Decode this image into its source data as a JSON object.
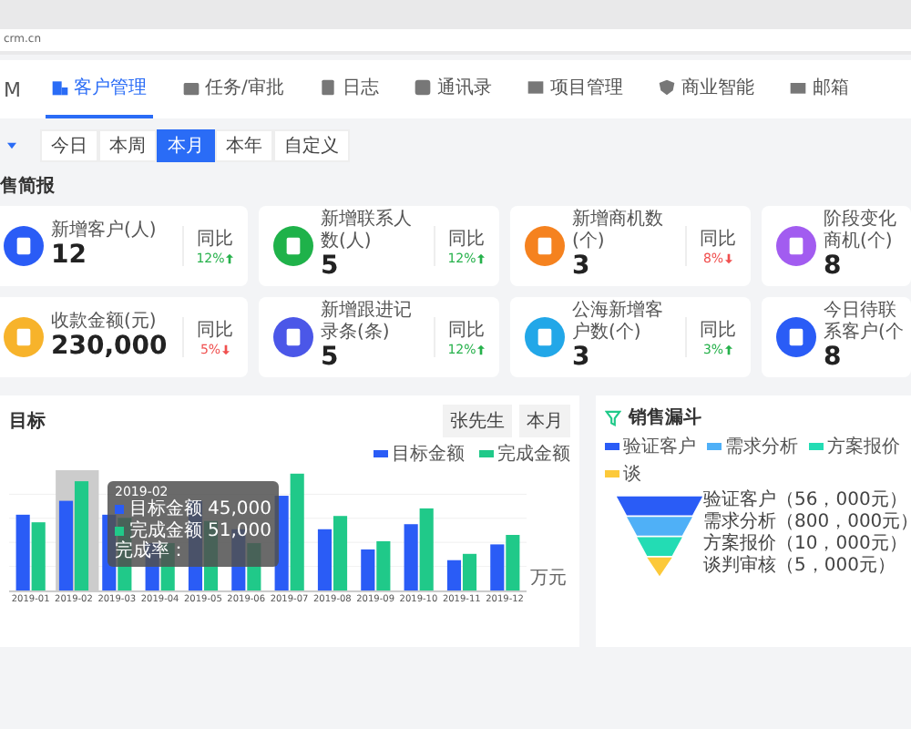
{
  "browser": {
    "address": "crm.cn"
  },
  "logo_fragment": "M",
  "nav": [
    {
      "label": "客户管理",
      "selected": true
    },
    {
      "label": "任务/审批",
      "selected": false
    },
    {
      "label": "日志",
      "selected": false
    },
    {
      "label": "通讯录",
      "selected": false
    },
    {
      "label": "项目管理",
      "selected": false
    },
    {
      "label": "商业智能",
      "selected": false
    },
    {
      "label": "邮箱",
      "selected": false
    }
  ],
  "period_filter": [
    {
      "label": "今日",
      "selected": false
    },
    {
      "label": "本周",
      "selected": false
    },
    {
      "label": "本月",
      "selected": true
    },
    {
      "label": "本年",
      "selected": false
    },
    {
      "label": "自定义",
      "selected": false
    }
  ],
  "section_title": "售简报",
  "cards": [
    {
      "label": "新增客户(人)",
      "value": "12",
      "compare": "同比",
      "change": "12%",
      "rising": true,
      "color": "#2a5cf6"
    },
    {
      "label": "新增联系人数(人)",
      "value": "5",
      "compare": "同比",
      "change": "12%",
      "rising": true,
      "color": "#1fb24a"
    },
    {
      "label": "新增商机数(个)",
      "value": "3",
      "compare": "同比",
      "change": "8%",
      "rising": false,
      "color": "#f5821f"
    },
    {
      "label": "阶段变化商机(个)",
      "value": "8",
      "color": "#a25cf0"
    },
    {
      "label": "收款金额(元)",
      "value": "230,000",
      "compare": "同比",
      "change": "5%",
      "rising": false,
      "color": "#f7b32b"
    },
    {
      "label": "新增跟进记录条(条)",
      "value": "5",
      "compare": "同比",
      "change": "12%",
      "rising": true,
      "color": "#4b57e8"
    },
    {
      "label": "公海新增客户数(个)",
      "value": "3",
      "compare": "同比",
      "change": "3%",
      "rising": true,
      "color": "#22a7e8"
    },
    {
      "label": "今日待联系客户(个",
      "value": "8",
      "color": "#2a5cf6"
    }
  ],
  "target_panel": {
    "title": "目标",
    "buttons": [
      "张先生",
      "本月"
    ],
    "legend": [
      {
        "label": "目标金额",
        "color": "#2a5cf6"
      },
      {
        "label": "完成金额",
        "color": "#20c989"
      }
    ],
    "x_labels": [
      "2019-01",
      "2019-02",
      "2019-03",
      "2019-04",
      "2019-05",
      "2019-06",
      "2019-07",
      "2019-08",
      "2019-09",
      "2019-10",
      "2019-11",
      "2019-12"
    ],
    "unit": "万元",
    "tooltip": {
      "title": "2019-02",
      "rows": [
        {
          "label": "目标金额",
          "value": "45,000",
          "color": "#2a5cf6"
        },
        {
          "label": "完成金额",
          "value": "51,000",
          "color": "#20c989"
        }
      ],
      "footer": "完成率："
    }
  },
  "funnel_panel": {
    "title": "销售漏斗",
    "stages": [
      {
        "legend": "验证客户",
        "label": "验证客户（56，000元）",
        "color": "#2a5cf6"
      },
      {
        "legend": "需求分析",
        "label": "需求分析（800，000元）",
        "color": "#4fb0f7"
      },
      {
        "legend": "方案报价",
        "label": "方案报价（10，000元）",
        "color": "#23dcb4"
      },
      {
        "legend": "谈",
        "label": "谈判审核（5，000元）",
        "color": "#fcc93a"
      }
    ]
  }
}
